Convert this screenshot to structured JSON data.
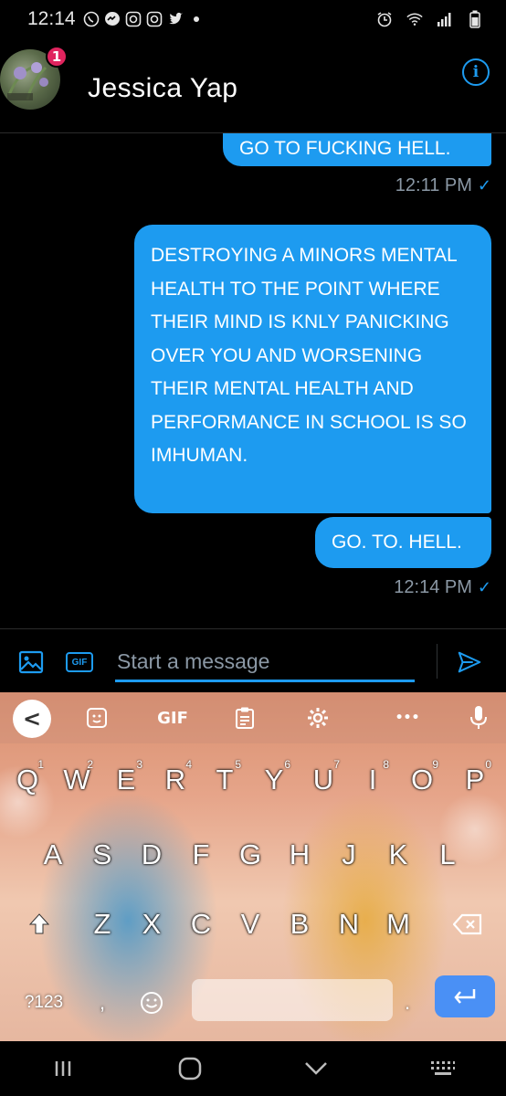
{
  "status_bar": {
    "time": "12:14",
    "left_icons": [
      "whatsapp-icon",
      "messenger-icon",
      "instagram-icon",
      "instagram-icon",
      "twitter-icon",
      "dot-icon"
    ],
    "right_icons": [
      "alarm-icon",
      "wifi-icon",
      "signal-icon",
      "battery-icon"
    ]
  },
  "header": {
    "contact_name": "Jessica Yap",
    "badge_count": "1",
    "info_glyph": "i"
  },
  "messages": [
    {
      "text": "GO TO FUCKING HELL."
    },
    {
      "timestamp": "12:11 PM"
    },
    {
      "text": "DESTROYING A MINORS MENTAL HEALTH TO THE POINT WHERE THEIR MIND IS KNLY PANICKING OVER YOU AND WORSENING THEIR MENTAL HEALTH AND PERFORMANCE IN SCHOOL IS SO IMHUMAN."
    },
    {
      "text": "GO. TO. HELL."
    },
    {
      "timestamp": "12:14 PM"
    }
  ],
  "composer": {
    "placeholder": "Start a message",
    "gif_label": "GIF"
  },
  "keyboard": {
    "toolbar": {
      "back": "<",
      "gif": "GIF",
      "more": "•••"
    },
    "row1": [
      {
        "key": "Q",
        "hint": "1"
      },
      {
        "key": "W",
        "hint": "2"
      },
      {
        "key": "E",
        "hint": "3"
      },
      {
        "key": "R",
        "hint": "4"
      },
      {
        "key": "T",
        "hint": "5"
      },
      {
        "key": "Y",
        "hint": "6"
      },
      {
        "key": "U",
        "hint": "7"
      },
      {
        "key": "I",
        "hint": "8"
      },
      {
        "key": "O",
        "hint": "9"
      },
      {
        "key": "P",
        "hint": "0"
      }
    ],
    "row2": [
      "A",
      "S",
      "D",
      "F",
      "G",
      "H",
      "J",
      "K",
      "L"
    ],
    "row3": [
      "Z",
      "X",
      "C",
      "V",
      "B",
      "N",
      "M"
    ],
    "sym_label": "?123",
    "comma": ",",
    "period": "."
  },
  "colors": {
    "accent": "#1d9bf0",
    "badge": "#e0245e",
    "timestamp": "#8b98a5",
    "enter_key": "#4a90f5"
  }
}
